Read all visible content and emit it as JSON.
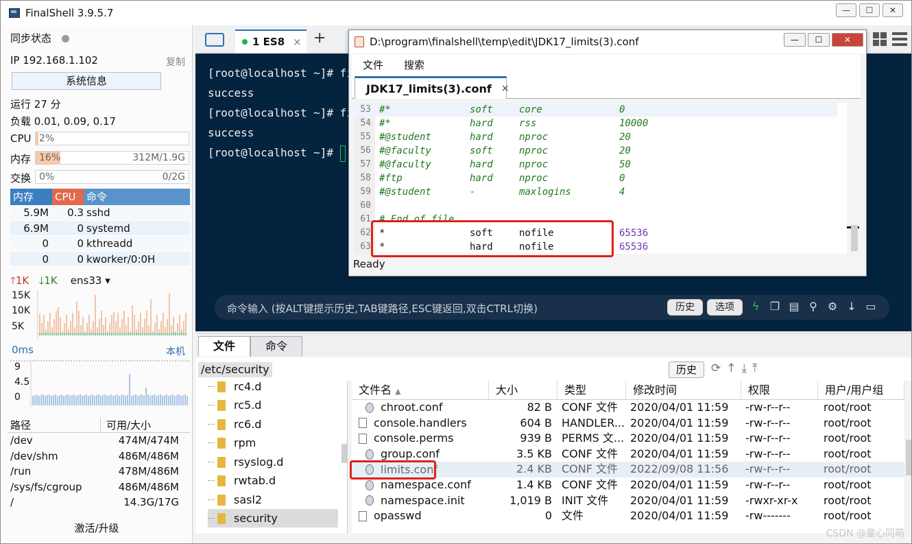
{
  "window": {
    "title": "FinalShell 3.9.5.7",
    "min": "—",
    "max": "☐",
    "close": "✕"
  },
  "left": {
    "sync_label": "同步状态",
    "ip": "IP 192.168.1.102",
    "copy": "复制",
    "sysinfo": "系统信息",
    "uptime": "运行 27 分",
    "load": "负载 0.01, 0.09, 0.17",
    "cpu": {
      "label": "CPU",
      "value": "2%",
      "fraction": 0.02
    },
    "mem": {
      "label": "内存",
      "value": "16%",
      "total": "312M/1.9G",
      "fraction": 0.16
    },
    "swap": {
      "label": "交换",
      "value": "0%",
      "total": "0/2G",
      "fraction": 0
    },
    "proc_headers": [
      "内存",
      "CPU",
      "命令"
    ],
    "procs": [
      {
        "mem": "5.9M",
        "cpu": "0.3",
        "cmd": "sshd"
      },
      {
        "mem": "6.9M",
        "cpu": "0",
        "cmd": "systemd"
      },
      {
        "mem": "0",
        "cpu": "0",
        "cmd": "kthreadd"
      },
      {
        "mem": "0",
        "cpu": "0",
        "cmd": "kworker/0:0H"
      }
    ],
    "net": {
      "up": "1K",
      "down": "1K",
      "iface": "ens33",
      "ticks": [
        "15K",
        "10K",
        "5K"
      ]
    },
    "latency": {
      "value": "0ms",
      "target": "本机",
      "ticks": [
        "9",
        "4.5",
        "0"
      ]
    },
    "disk_headers": [
      "路径",
      "可用/大小"
    ],
    "disks": [
      {
        "path": "/dev",
        "size": "474M/474M"
      },
      {
        "path": "/dev/shm",
        "size": "486M/486M"
      },
      {
        "path": "/run",
        "size": "478M/486M"
      },
      {
        "path": "/sys/fs/cgroup",
        "size": "486M/486M"
      },
      {
        "path": "/",
        "size": "14.3G/17G"
      }
    ],
    "activate": "激活/升级"
  },
  "tabs": {
    "session": "1 ES8",
    "close": "×",
    "add": "+"
  },
  "terminal": {
    "lines": [
      "[root@localhost ~]# fir",
      "success",
      "[root@localhost ~]# fir",
      "success",
      "[root@localhost ~]# "
    ],
    "cmd_placeholder": "命令输入 (按ALT键提示历史,TAB键路径,ESC键返回,双击CTRL切换)",
    "history_btn": "历史",
    "options_btn": "选项"
  },
  "files_panel": {
    "tab_files": "文件",
    "tab_cmd": "命令",
    "path": "/etc/security",
    "history_btn": "历史",
    "tree": [
      "rc4.d",
      "rc5.d",
      "rc6.d",
      "rpm",
      "rsyslog.d",
      "rwtab.d",
      "sasl2",
      "security"
    ],
    "headers": [
      "文件名",
      "大小",
      "类型",
      "修改时间",
      "权限",
      "用户/用户组"
    ],
    "rows": [
      {
        "name": "chroot.conf",
        "size": "82 B",
        "type": "CONF 文件",
        "time": "2020/04/01 11:59",
        "perm": "-rw-r--r--",
        "user": "root/root"
      },
      {
        "name": "console.handlers",
        "size": "604 B",
        "type": "HANDLER...",
        "time": "2020/04/01 11:59",
        "perm": "-rw-r--r--",
        "user": "root/root"
      },
      {
        "name": "console.perms",
        "size": "939 B",
        "type": "PERMS 文...",
        "time": "2020/04/01 11:59",
        "perm": "-rw-r--r--",
        "user": "root/root"
      },
      {
        "name": "group.conf",
        "size": "3.5 KB",
        "type": "CONF 文件",
        "time": "2020/04/01 11:59",
        "perm": "-rw-r--r--",
        "user": "root/root"
      },
      {
        "name": "limits.conf",
        "size": "2.4 KB",
        "type": "CONF 文件",
        "time": "2022/09/08 11:56",
        "perm": "-rw-r--r--",
        "user": "root/root"
      },
      {
        "name": "namespace.conf",
        "size": "1.4 KB",
        "type": "CONF 文件",
        "time": "2020/04/01 11:59",
        "perm": "-rw-r--r--",
        "user": "root/root"
      },
      {
        "name": "namespace.init",
        "size": "1,019 B",
        "type": "INIT 文件",
        "time": "2020/04/01 11:59",
        "perm": "-rwxr-xr-x",
        "user": "root/root"
      },
      {
        "name": "opasswd",
        "size": "0",
        "type": "文件",
        "time": "2020/04/01 11:59",
        "perm": "-rw-------",
        "user": "root/root"
      }
    ]
  },
  "editor": {
    "title": "D:\\program\\finalshell\\temp\\edit\\JDK17_limits(3).conf",
    "menu": [
      "文件",
      "搜索"
    ],
    "tab": "JDK17_limits(3).conf",
    "tab_close": "×",
    "status": "Ready",
    "lines": [
      {
        "n": "53",
        "a": "#*",
        "b": "soft",
        "c": "core",
        "d": "0"
      },
      {
        "n": "54",
        "a": "#*",
        "b": "hard",
        "c": "rss",
        "d": "10000"
      },
      {
        "n": "55",
        "a": "#@student",
        "b": "hard",
        "c": "nproc",
        "d": "20"
      },
      {
        "n": "56",
        "a": "#@faculty",
        "b": "soft",
        "c": "nproc",
        "d": "20"
      },
      {
        "n": "57",
        "a": "#@faculty",
        "b": "hard",
        "c": "nproc",
        "d": "50"
      },
      {
        "n": "58",
        "a": "#ftp",
        "b": "hard",
        "c": "nproc",
        "d": "0"
      },
      {
        "n": "59",
        "a": "#@student",
        "b": "-",
        "c": "maxlogins",
        "d": "4"
      },
      {
        "n": "60",
        "a": "",
        "b": "",
        "c": "",
        "d": ""
      },
      {
        "n": "61",
        "a": "# End of file",
        "b": "",
        "c": "",
        "d": ""
      },
      {
        "n": "62",
        "a": "*",
        "b": "soft",
        "c": "nofile",
        "d": "65536"
      },
      {
        "n": "63",
        "a": "*",
        "b": "hard",
        "c": "nofile",
        "d": "65536"
      }
    ]
  },
  "watermark": "CSDN @童心同萌",
  "colors": {
    "accent": "#2e6fb0",
    "terminal_bg": "#04233f",
    "highlight": "#e0201a"
  }
}
